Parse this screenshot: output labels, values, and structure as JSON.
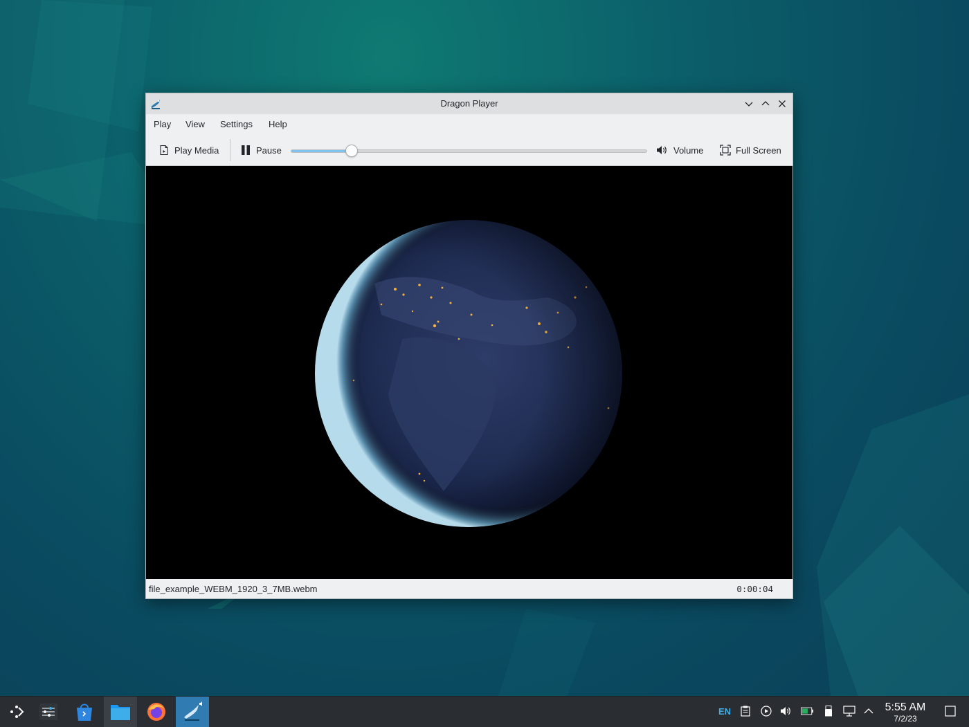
{
  "window": {
    "title": "Dragon Player",
    "controls": {
      "minimize": "chevron-down-icon",
      "maximize": "chevron-up-icon",
      "close": "close-icon"
    }
  },
  "menu": [
    "Play",
    "View",
    "Settings",
    "Help"
  ],
  "toolbar": {
    "play_media": "Play Media",
    "pause": "Pause",
    "volume": "Volume",
    "full_screen": "Full Screen",
    "seek_progress": 0.17
  },
  "status": {
    "filename": "file_example_WEBM_1920_3_7MB.webm",
    "time": "0:00:04"
  },
  "taskbar": {
    "apps": [
      "launcher-icon",
      "system-settings-icon",
      "discover-icon",
      "dolphin-icon",
      "firefox-icon",
      "dragon-player-icon"
    ],
    "tray": {
      "language": "EN",
      "time": "5:55 AM",
      "date": "7/2/23"
    }
  },
  "colors": {
    "accent": "#3daee9",
    "slider_fill": "#7fc1ef",
    "taskbar": "#2a2e32",
    "active_task": "#2f7bb2"
  }
}
